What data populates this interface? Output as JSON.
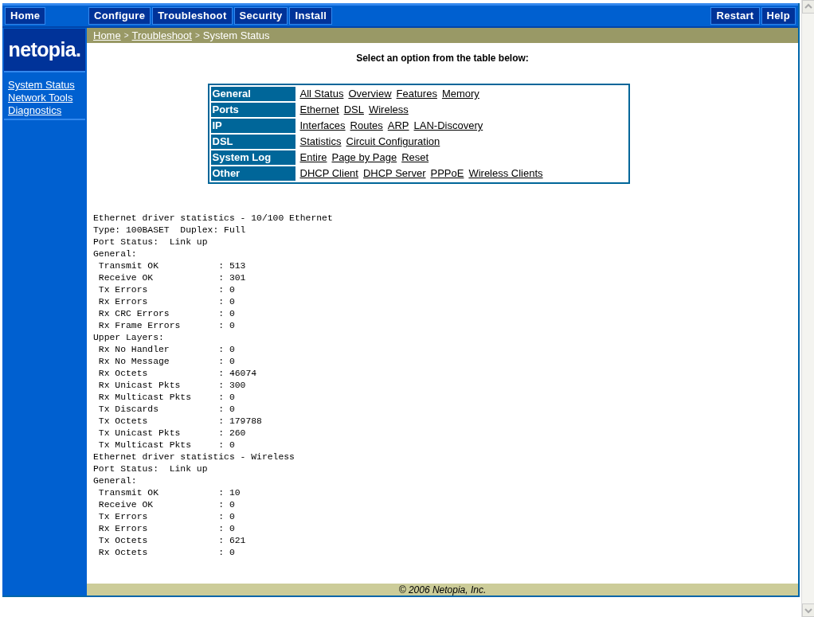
{
  "nav": {
    "left": [
      {
        "label": "Home"
      }
    ],
    "middle": [
      {
        "label": "Configure"
      },
      {
        "label": "Troubleshoot"
      },
      {
        "label": "Security"
      },
      {
        "label": "Install"
      }
    ],
    "right": [
      {
        "label": "Restart"
      },
      {
        "label": "Help"
      }
    ]
  },
  "logo": "netopia.",
  "sidebar": {
    "items": [
      {
        "label": "System Status"
      },
      {
        "label": "Network Tools"
      },
      {
        "label": "Diagnostics"
      }
    ]
  },
  "breadcrumb": {
    "links": [
      "Home",
      "Troubleshoot"
    ],
    "separator": ">",
    "current": "System Status"
  },
  "prompt": "Select an option from the table below:",
  "options": [
    {
      "category": "General",
      "links": [
        "All Status",
        "Overview",
        "Features",
        "Memory"
      ]
    },
    {
      "category": "Ports",
      "links": [
        "Ethernet",
        "DSL",
        "Wireless"
      ]
    },
    {
      "category": "IP",
      "links": [
        "Interfaces",
        "Routes",
        "ARP",
        "LAN-Discovery"
      ]
    },
    {
      "category": "DSL",
      "links": [
        "Statistics",
        "Circuit Configuration"
      ]
    },
    {
      "category": "System Log",
      "links": [
        "Entire",
        "Page by Page",
        "Reset"
      ]
    },
    {
      "category": "Other",
      "links": [
        "DHCP Client",
        "DHCP Server",
        "PPPoE",
        "Wireless Clients"
      ]
    }
  ],
  "output_lines": [
    "Ethernet driver statistics - 10/100 Ethernet",
    "Type: 100BASET  Duplex: Full",
    "Port Status:  Link up",
    "General:",
    " Transmit OK           : 513",
    " Receive OK            : 301",
    " Tx Errors             : 0",
    " Rx Errors             : 0",
    " Rx CRC Errors         : 0",
    " Rx Frame Errors       : 0",
    "Upper Layers:",
    " Rx No Handler         : 0",
    " Rx No Message         : 0",
    " Rx Octets             : 46074",
    " Rx Unicast Pkts       : 300",
    " Rx Multicast Pkts     : 0",
    " Tx Discards           : 0",
    " Tx Octets             : 179788",
    " Tx Unicast Pkts       : 260",
    " Tx Multicast Pkts     : 0",
    "Ethernet driver statistics - Wireless",
    "Port Status:  Link up",
    "General:",
    " Transmit OK           : 10",
    " Receive OK            : 0",
    " Tx Errors             : 0",
    " Rx Errors             : 0",
    " Tx Octets             : 621",
    " Rx Octets             : 0"
  ],
  "footer": "© 2006 Netopia, Inc."
}
